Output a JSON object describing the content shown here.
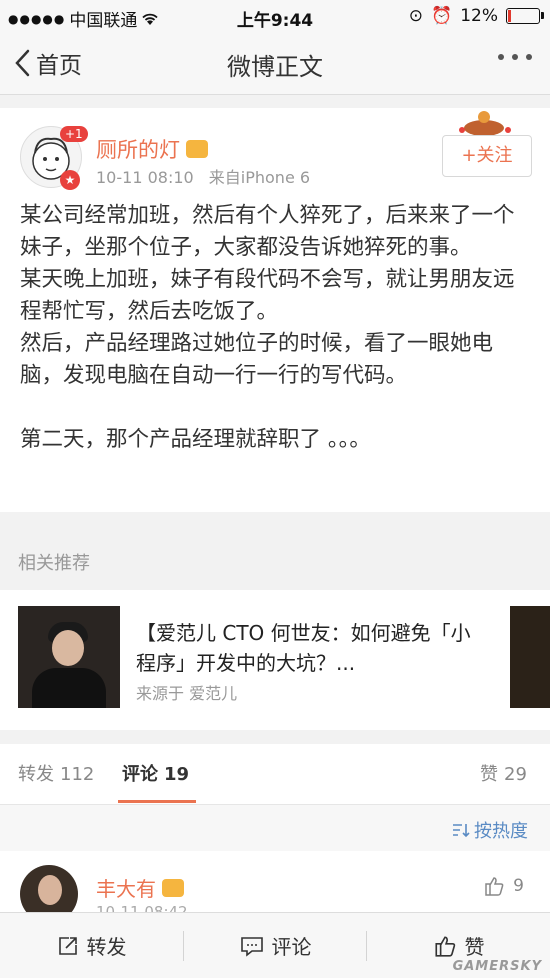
{
  "status_bar": {
    "carrier": "中国联通",
    "time": "上午9:44",
    "battery": "12%",
    "battery_level": 0.12
  },
  "nav": {
    "back_label": "首页",
    "title": "微博正文"
  },
  "post": {
    "username": "厕所的灯",
    "badge_count": "+1",
    "time": "10-11 08:10",
    "source": "来自iPhone 6",
    "follow_label": "+关注",
    "paragraphs": [
      "某公司经常加班，然后有个人猝死了，后来来了一个妹子，坐那个位子，大家都没告诉她猝死的事。",
      "某天晚上加班，妹子有段代码不会写，就让男朋友远程帮忙写，然后去吃饭了。",
      "然后，产品经理路过她位子的时候，看了一眼她电脑，发现电脑在自动一行一行的写代码。",
      "第二天，那个产品经理就辞职了 。。。"
    ]
  },
  "recommend": {
    "label": "相关推荐",
    "title": "【爱范儿 CTO 何世友：如何避免「小程序」开发中的大坑？...",
    "source": "来源于 爱范儿"
  },
  "tabs": {
    "repost_label": "转发",
    "repost_count": "112",
    "comment_label": "评论",
    "comment_count": "19",
    "like_label": "赞",
    "like_count": "29"
  },
  "sort": {
    "label": "按热度"
  },
  "comment": {
    "username": "丰大有",
    "likes": "9",
    "time": "10-11 08:42"
  },
  "bottom_bar": {
    "repost": "转发",
    "comment": "评论",
    "like": "赞"
  },
  "watermark": "GAMERSKY",
  "colors": {
    "accent": "#eb7350",
    "link": "#5a8bc4"
  }
}
